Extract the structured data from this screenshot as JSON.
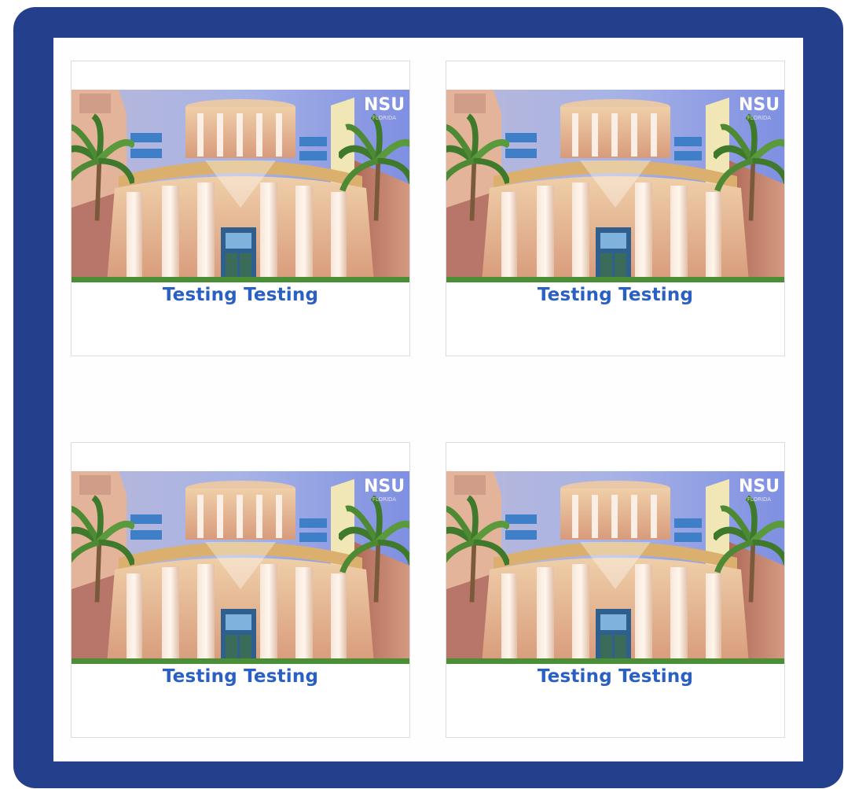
{
  "colors": {
    "frame": "#243f8c",
    "title": "#2a5fc4",
    "card_border": "#dcdcdc"
  },
  "logo_text": "NSU",
  "cards": [
    {
      "title": "Testing Testing",
      "image": "university-building-photo"
    },
    {
      "title": "Testing Testing",
      "image": "university-building-photo"
    },
    {
      "title": "Testing Testing",
      "image": "university-building-photo"
    },
    {
      "title": "Testing Testing",
      "image": "university-building-photo"
    }
  ]
}
